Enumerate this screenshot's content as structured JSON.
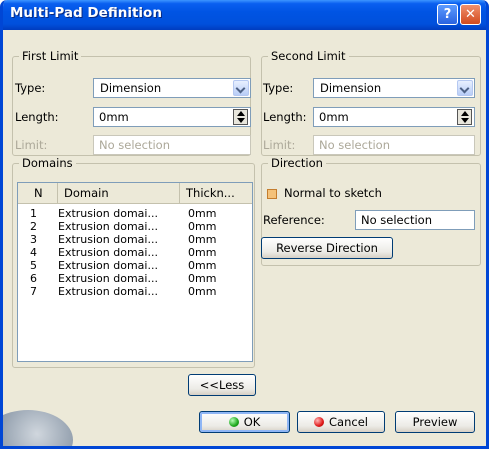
{
  "window": {
    "title": "Multi-Pad Definition"
  },
  "first_limit": {
    "legend": "First Limit",
    "type_label": "Type:",
    "type_value": "Dimension",
    "length_label": "Length:",
    "length_value": "0mm",
    "limit_label": "Limit:",
    "limit_value": "No selection"
  },
  "second_limit": {
    "legend": "Second Limit",
    "type_label": "Type:",
    "type_value": "Dimension",
    "length_label": "Length:",
    "length_value": "0mm",
    "limit_label": "Limit:",
    "limit_value": "No selection"
  },
  "domains": {
    "legend": "Domains",
    "headers": [
      "N",
      "Domain",
      "Thickn..."
    ],
    "rows": [
      [
        "1",
        "Extrusion domai...",
        "0mm"
      ],
      [
        "2",
        "Extrusion domai...",
        "0mm"
      ],
      [
        "3",
        "Extrusion domai...",
        "0mm"
      ],
      [
        "4",
        "Extrusion domai...",
        "0mm"
      ],
      [
        "5",
        "Extrusion domai...",
        "0mm"
      ],
      [
        "6",
        "Extrusion domai...",
        "0mm"
      ],
      [
        "7",
        "Extrusion domai...",
        "0mm"
      ]
    ]
  },
  "direction": {
    "legend": "Direction",
    "normal_label": "Normal to sketch",
    "normal_checked": true,
    "reference_label": "Reference:",
    "reference_value": "No selection",
    "reverse_button": "Reverse Direction"
  },
  "buttons": {
    "less": "<<Less",
    "ok": "OK",
    "cancel": "Cancel",
    "preview": "Preview"
  },
  "colors": {
    "titlebar": "#0054e3",
    "dialog_bg": "#ece9d8",
    "close": "#d24a1e"
  }
}
